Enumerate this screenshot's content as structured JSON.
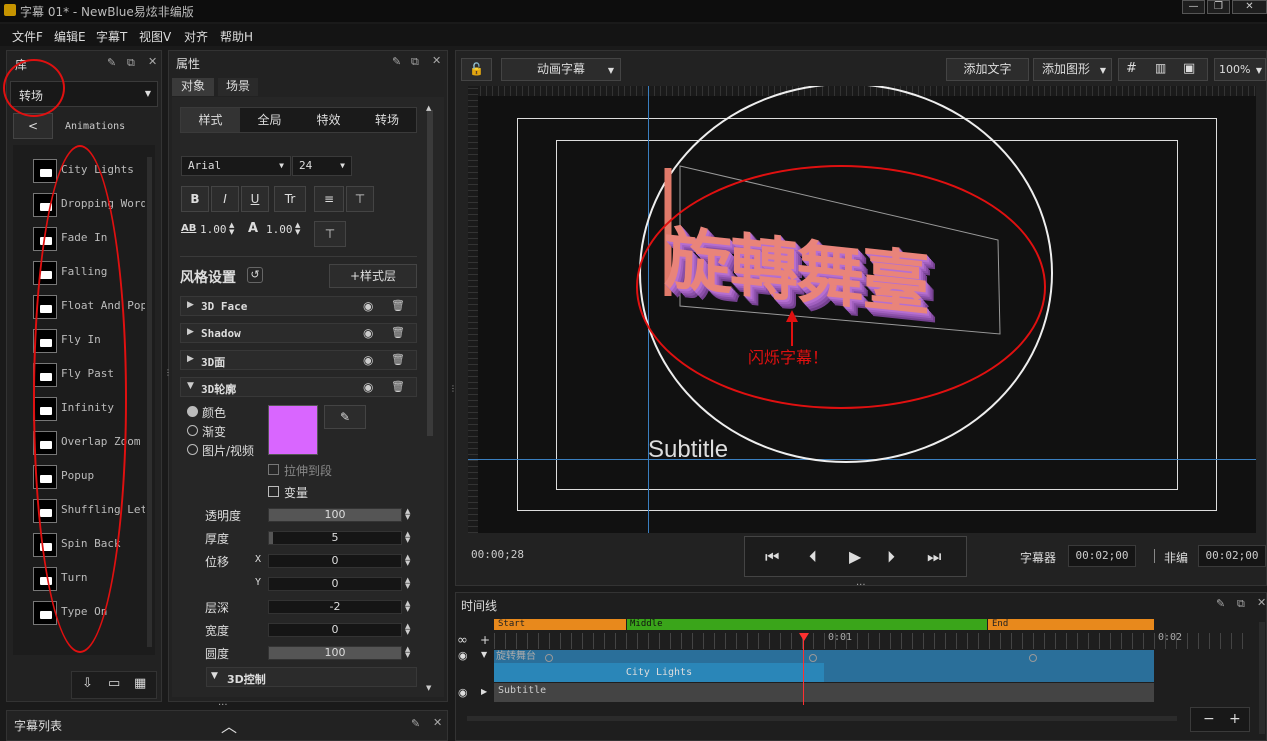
{
  "window": {
    "title": "字幕 01* - NewBlue易炫非编版"
  },
  "menu": [
    "文件F",
    "编辑E",
    "字幕T",
    "视图V",
    "对齐",
    "帮助H"
  ],
  "library": {
    "title": "库",
    "category": "转场",
    "breadcrumb_back": "<",
    "breadcrumb": "Animations",
    "items": [
      "City Lights",
      "Dropping Words",
      "Fade In",
      "Falling",
      "Float And Pop",
      "Fly In",
      "Fly Past",
      "Infinity",
      "Overlap Zoom",
      "Popup",
      "Shuffling Letters",
      "Spin Back",
      "Turn",
      "Type On"
    ]
  },
  "caption_list": {
    "title": "字幕列表"
  },
  "properties": {
    "title": "属性",
    "tabs": [
      "对象",
      "场景"
    ],
    "subtabs": [
      "样式",
      "全局",
      "特效",
      "转场"
    ],
    "font": "Arial",
    "font_size": "24",
    "bold": "B",
    "italic": "I",
    "underline": "U",
    "text_transform": "Tr",
    "align_h": "≡",
    "align_v": "⊤",
    "baseline": "⊤",
    "char_spacing_label": "AB",
    "char_spacing": "1.00",
    "line_spacing": "1.00",
    "style_settings": "风格设置",
    "add_style_layer": "+样式层",
    "layers": [
      "3D Face",
      "Shadow",
      "3D面",
      "3D轮廓"
    ],
    "fill_color_label": "颜色",
    "gradient_label": "渐变",
    "image_video_label": "图片/视频",
    "stretch_label": "拉伸到段",
    "variable_label": "变量",
    "fill_color": "#d966ff",
    "rows": [
      {
        "label": "透明度",
        "axis": "",
        "value": "100",
        "fill": 1.0
      },
      {
        "label": "厚度",
        "axis": "",
        "value": "5",
        "fill": 0.03
      },
      {
        "label": "位移",
        "axis": "X",
        "value": "0",
        "fill": 0
      },
      {
        "label": "",
        "axis": "Y",
        "value": "0",
        "fill": 0
      },
      {
        "label": "层深",
        "axis": "",
        "value": "-2",
        "fill": 0
      },
      {
        "label": "宽度",
        "axis": "",
        "value": "0",
        "fill": 0
      },
      {
        "label": "圆度",
        "axis": "",
        "value": "100",
        "fill": 1.0
      }
    ],
    "section_3d": "3D控制"
  },
  "toolbar": {
    "animation": "动画字幕",
    "add_text": "添加文字",
    "add_shape": "添加图形",
    "zoom": "100%"
  },
  "canvas": {
    "main_text": "旋轉舞臺",
    "annotation": "闪烁字幕！",
    "subtitle": "Subtitle"
  },
  "playback": {
    "current_time": "00:00;28",
    "caption_duration_label": "字幕器",
    "caption_duration": "00:02;00",
    "edit_label": "非编",
    "edit_duration": "00:02;00"
  },
  "timeline": {
    "title": "时间线",
    "segments": [
      "Start",
      "Middle",
      "End"
    ],
    "ruler": [
      "0:01",
      "0:02"
    ],
    "track1_name": "旋转舞台",
    "clip": "City Lights",
    "track2_name": "Subtitle",
    "zoom_out": "−",
    "zoom_in": "+"
  },
  "colors": {
    "seg_start": "#e8891c",
    "seg_middle": "#3aa51a",
    "seg_end": "#e8891c",
    "clip": "#2a86b8",
    "playhead": "#ff3030",
    "annotation": "#e01010"
  }
}
